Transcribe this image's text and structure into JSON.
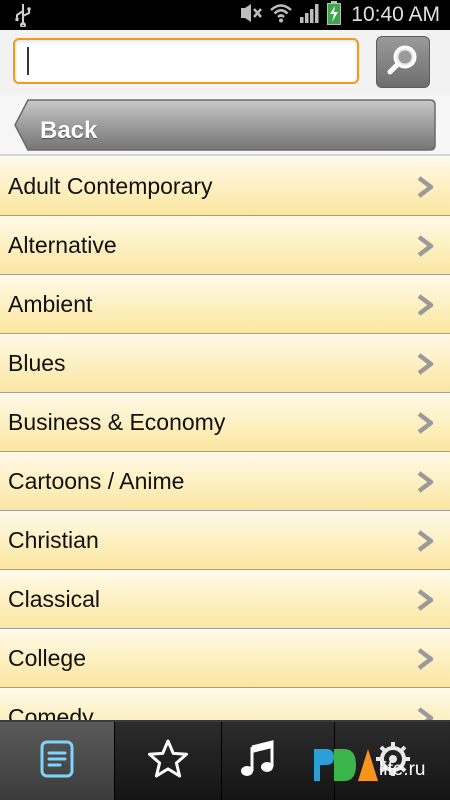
{
  "status_bar": {
    "time": "10:40 AM",
    "icons": [
      "usb-icon",
      "mute-icon",
      "wifi-icon",
      "signal-icon",
      "battery-charging-icon"
    ]
  },
  "search": {
    "value": "",
    "placeholder": "",
    "button_icon": "search-icon"
  },
  "back": {
    "label": "Back"
  },
  "genres": [
    "Adult Contemporary",
    "Alternative",
    "Ambient",
    "Blues",
    "Business & Economy",
    "Cartoons / Anime",
    "Christian",
    "Classical",
    "College",
    "Comedy"
  ],
  "tabs": [
    {
      "icon": "list-icon",
      "active": true
    },
    {
      "icon": "star-icon",
      "active": false
    },
    {
      "icon": "music-note-icon",
      "active": false
    },
    {
      "icon": "settings-icon",
      "active": false
    }
  ],
  "watermark": {
    "text": "PDAlife.ru"
  },
  "colors": {
    "search_border": "#f29a1e",
    "list_bg_top": "#fefaea",
    "list_bg_bottom": "#fbe6a1",
    "tab_active": "#4a4a4a",
    "list_icon": "#7fd3ff"
  }
}
